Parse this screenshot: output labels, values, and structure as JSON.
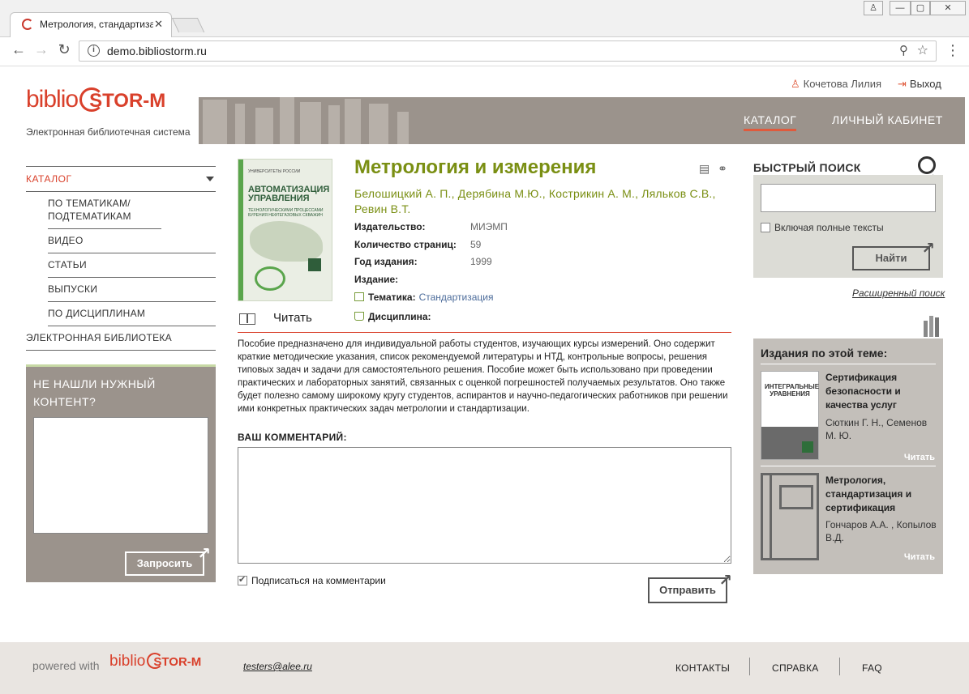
{
  "browser": {
    "tab_title": "Метрология, стандартиза",
    "url": "demo.bibliostorm.ru",
    "win_controls": [
      "—",
      "▢",
      "✕"
    ]
  },
  "header": {
    "user_name": "Кочетова Лилия",
    "logout": "Выход",
    "logo_part1": "biblio",
    "logo_part2": "STOR-M",
    "logo_subtitle": "Электронная библиотечная система",
    "nav": [
      "КАТАЛОГ",
      "ЛИЧНЫЙ КАБИНЕТ"
    ]
  },
  "sidebar": {
    "catalog_label": "КАТАЛОГ",
    "items": [
      {
        "label": "ПО ТЕМАТИКАМ/ ПОДТЕМАТИКАМ"
      },
      {
        "label": "ВИДЕО"
      },
      {
        "label": "СТАТЬИ"
      },
      {
        "label": "ВЫПУСКИ"
      },
      {
        "label": "ПО ДИСЦИПЛИНАМ"
      }
    ],
    "library_label": "ЭЛЕКТРОННАЯ БИБЛИОТЕКА",
    "request_box": {
      "title": "НЕ НАШЛИ НУЖНЫЙ КОНТЕНТ?",
      "button": "Запросить"
    }
  },
  "book": {
    "cover": {
      "top_text": "УНИВЕРСИТЕТЫ РОССИИ",
      "title": "АВТОМАТИЗАЦИЯ УПРАВЛЕНИЯ",
      "subtitle": "ТЕХНОЛОГИЧЕСКИМИ ПРОЦЕССАМИ БУРЕНИЯ НЕФТЕГАЗОВЫХ СКВАЖИН"
    },
    "read_label": "Читать",
    "title": "Метрология и измерения",
    "authors": "Белошицкий А. П., Дерябина М.Ю., Кострикин А. М., Ляльков С.В., Ревин В.Т.",
    "meta": [
      {
        "key": "Издательство:",
        "value": "МИЭМП"
      },
      {
        "key": "Количество страниц:",
        "value": "59"
      },
      {
        "key": "Год издания:",
        "value": "1999"
      },
      {
        "key": "Издание:",
        "value": ""
      }
    ],
    "topic_key": "Тематика:",
    "topic_value": "Стандартизация",
    "discipline_key": "Дисциплина:",
    "description": "Пособие предназначено для индивидуальной работы студентов, изучающих курсы измерений. Оно содержит краткие методические указания, список рекомендуемой литературы и НТД, контрольные вопросы, решения типовых задач и задачи для самостоятельного решения. Пособие может быть использовано при проведении практических и лабораторных занятий, связанных с оценкой погрешностей получаемых результатов. Оно также будет полезно самому широкому кругу студентов, аспирантов и научно-педагогических работников при решении ими конкретных практических задач метрологии и стандартизации."
  },
  "comment": {
    "label": "ВАШ КОММЕНТАРИЙ:",
    "subscribe_label": "Подписаться на комментарии",
    "send": "Отправить"
  },
  "quick_search": {
    "title": "БЫСТРЫЙ ПОИСК",
    "include_full": "Включая полные тексты",
    "find": "Найти",
    "advanced": "Расширенный поиск"
  },
  "related": {
    "title": "Издания по этой теме:",
    "items": [
      {
        "title": "Сертификация безопасности и качества услуг",
        "authors": "Сюткин Г. Н., Семенов М. Ю.",
        "read": "Читать",
        "cover_text": "ИНТЕГРАЛЬНЫЕ УРАВНЕНИЯ"
      },
      {
        "title": "Метрология, стандартизация и сертификация",
        "authors": "Гончаров А.А. , Копылов В.Д.",
        "read": "Читать"
      }
    ]
  },
  "footer": {
    "powered": "powered with",
    "logo_part1": "biblio",
    "logo_part2": "STOR-M",
    "email": "testers@alee.ru",
    "links": [
      "КОНТАКТЫ",
      "СПРАВКА",
      "FAQ"
    ]
  },
  "colors": {
    "accent": "#d9402b",
    "title_green": "#7a8f13",
    "banner": "#9b938c"
  }
}
